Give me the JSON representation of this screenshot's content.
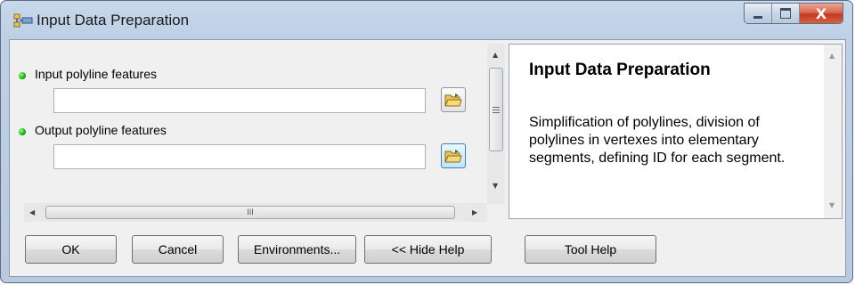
{
  "window": {
    "title": "Input Data Preparation",
    "close_glyph": "X",
    "icons": {
      "app": "toolbox-tool-icon",
      "minimize": "minimize-icon",
      "maximize": "maximize-icon",
      "close": "close-icon"
    }
  },
  "params": [
    {
      "label": "Input polyline features",
      "value": "",
      "required": true,
      "icon": "folder-open-icon"
    },
    {
      "label": "Output polyline features",
      "value": "",
      "required": true,
      "icon": "folder-open-icon"
    }
  ],
  "scrollbars": {
    "h_thumb_grip": "III"
  },
  "help": {
    "title": "Input Data Preparation",
    "description": "Simplification of polylines, division of polylines in vertexes into elementary segments, defining ID for each segment."
  },
  "buttons": {
    "ok": "OK",
    "cancel": "Cancel",
    "environments": "Environments...",
    "hide_help": "<< Hide Help",
    "tool_help": "Tool Help"
  },
  "colors": {
    "required_dot": "#0cae0c",
    "title_bar": "#bdd0e6",
    "close_button": "#c23a22"
  }
}
